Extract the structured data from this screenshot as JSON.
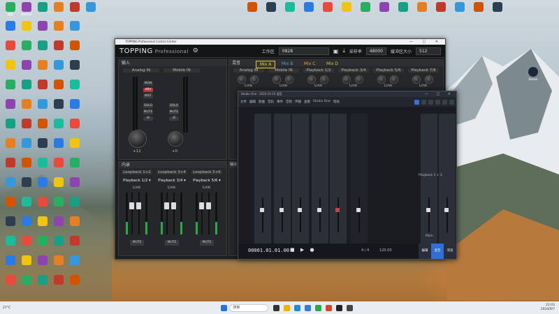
{
  "desktop": {
    "top_icons": [
      "跑跑",
      "WeChat",
      "",
      "",
      "",
      "",
      "",
      "",
      "",
      "",
      "",
      "",
      "",
      "",
      "",
      "",
      "",
      "",
      "",
      ""
    ],
    "left_icons_count": 70,
    "right_icon_label": "Steam"
  },
  "topping": {
    "window_title": "TOPPING Professional Control Center",
    "logo": "TOPPING",
    "logo_sub": "Professional",
    "workspace_label": "工作区",
    "workspace_value": "0828",
    "sample_rate_label": "采样率",
    "sample_rate_value": "48000",
    "buffer_label": "缓冲区大小",
    "buffer_value": "512",
    "input_panel": {
      "title": "输入",
      "channels": [
        {
          "name": "Analog IN",
          "buttons": [
            "MON",
            "48V",
            "INST",
            "SOLO",
            "MUTE",
            "Ø"
          ],
          "gain": "+12"
        },
        {
          "name": "Mobile IN",
          "buttons": [
            "SOLO",
            "MUTE",
            "Ø"
          ],
          "gain": "+0"
        }
      ]
    },
    "mix_panel": {
      "title": "混音",
      "tabs": [
        "Mix A",
        "Mix B",
        "Mix C",
        "Mix D"
      ],
      "tab_colors": [
        "#e8c740",
        "#4fa3e0",
        "#e8a83a",
        "#e0c040"
      ],
      "channels": [
        "Analog IN",
        "Mobile IN",
        "Playback 1/2",
        "Playback 3/4",
        "Playback 5/6",
        "Playback 7/8"
      ],
      "link_label": "Link"
    },
    "internal_panel": {
      "title": "内录",
      "tabs": [
        "Loopback 1+2",
        "Loopback 3+4",
        "Loopback 5+6"
      ],
      "channels": [
        {
          "select": "Playback 1/2",
          "link": "Link",
          "mute": "MUTE"
        },
        {
          "select": "Playback 3/4",
          "link": "Link",
          "mute": "MUTE"
        },
        {
          "select": "Playback 5/6",
          "link": "Link",
          "mute": "MUTE"
        }
      ]
    },
    "output_panel_title": "输出"
  },
  "studio_one": {
    "window_title": "Studio One - 2024-10-15 混音",
    "menus": [
      "文件",
      "编辑",
      "歌曲",
      "音轨",
      "事件",
      "音频",
      "传输",
      "查看",
      "Studio One",
      "帮助"
    ],
    "time_display": "00001.01.01.00",
    "tempo": "120.00",
    "signature": "4 / 4",
    "bottom_tabs": [
      "编辑",
      "混音",
      "浏览"
    ],
    "right_channel_label": "Main",
    "right_bus": "Playback 1 + 2"
  },
  "taskbar": {
    "search_placeholder": "搜索",
    "weather": "27°C",
    "time": "22:03",
    "date": "2024/9/7"
  }
}
